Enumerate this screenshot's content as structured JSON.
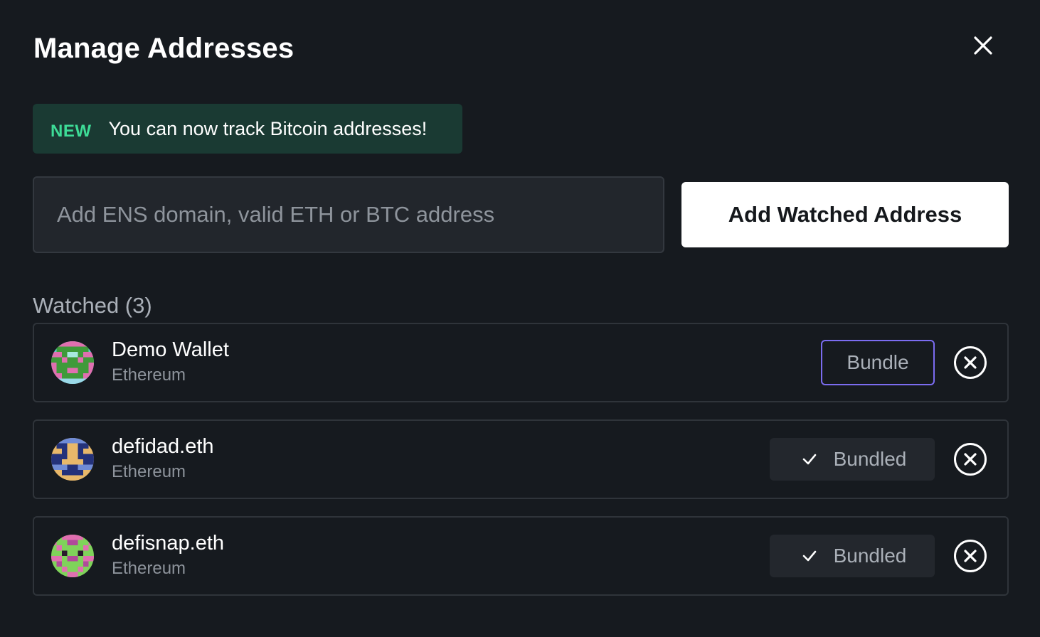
{
  "modal": {
    "title": "Manage Addresses",
    "close_icon": "close-icon"
  },
  "banner": {
    "tag": "NEW",
    "text": "You can now track Bitcoin addresses!",
    "accent_color": "#3ddc97",
    "background": "#1a3a33"
  },
  "add_address": {
    "input_value": "",
    "placeholder": "Add ENS domain, valid ETH or BTC address",
    "button_label": "Add Watched Address"
  },
  "watched": {
    "label": "Watched (3)",
    "items": [
      {
        "name": "Demo Wallet",
        "chain": "Ethereum",
        "avatar_icon": "pixel-avatar-icon",
        "action_label": "Bundle",
        "bundled": false,
        "remove_icon": "remove-circle-icon"
      },
      {
        "name": "defidad.eth",
        "chain": "Ethereum",
        "avatar_icon": "pixel-avatar-icon",
        "action_label": "Bundled",
        "bundled": true,
        "remove_icon": "remove-circle-icon"
      },
      {
        "name": "defisnap.eth",
        "chain": "Ethereum",
        "avatar_icon": "pixel-avatar-icon",
        "action_label": "Bundled",
        "bundled": true,
        "remove_icon": "remove-circle-icon"
      }
    ]
  },
  "colors": {
    "background": "#161a1f",
    "bundle_border": "#7b6cf0",
    "bundled_background": "#23272d",
    "muted_text": "#8e949c"
  }
}
